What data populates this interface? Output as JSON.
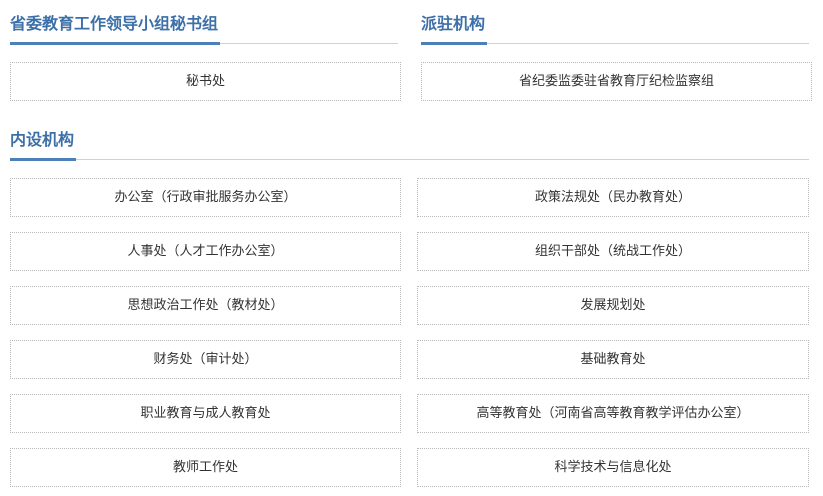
{
  "sections": {
    "leading_group": {
      "title": "省委教育工作领导小组秘书组",
      "items": [
        "秘书处"
      ]
    },
    "dispatched": {
      "title": "派驻机构",
      "items": [
        "省纪委监委驻省教育厅纪检监察组"
      ]
    },
    "internal": {
      "title": "内设机构",
      "items": [
        "办公室（行政审批服务办公室）",
        "政策法规处（民办教育处）",
        "人事处（人才工作办公室）",
        "组织干部处（统战工作处）",
        "思想政治工作处（教材处）",
        "发展规划处",
        "财务处（审计处）",
        "基础教育处",
        "职业教育与成人教育处",
        "高等教育处（河南省高等教育教学评估办公室）",
        "教师工作处",
        "科学技术与信息化处"
      ]
    }
  }
}
